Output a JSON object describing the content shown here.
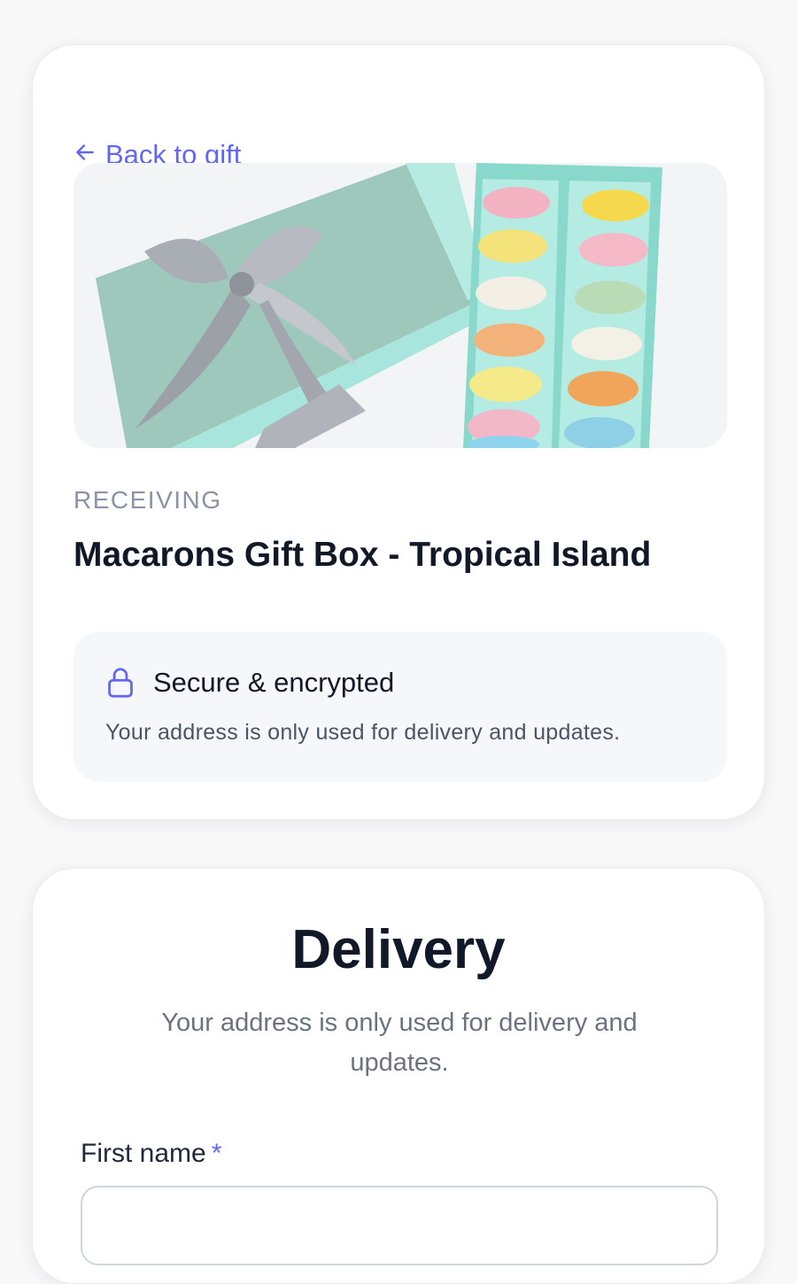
{
  "gift_card": {
    "back_link": {
      "label": "Back to gift",
      "icon": "arrow-left-icon"
    },
    "image": {
      "description_icon": "macaron-gift-box-image"
    },
    "eyebrow": "RECEIVING",
    "product_name": "Macarons Gift Box - Tropical Island",
    "security": {
      "icon": "lock-icon",
      "title": "Secure & encrypted",
      "text": "Your address is only used for delivery and updates."
    }
  },
  "delivery": {
    "title": "Delivery",
    "subtitle": "Your address is only used for delivery and updates.",
    "fields": [
      {
        "label": "First name",
        "required_mark": "*",
        "value": "",
        "placeholder": ""
      }
    ]
  },
  "colors": {
    "accent": "#6366f1",
    "text": "#111827",
    "muted": "#6b7280",
    "eyebrow": "#8a93a8",
    "panel": "#f6f7fa",
    "page": "#f8f8f9"
  }
}
